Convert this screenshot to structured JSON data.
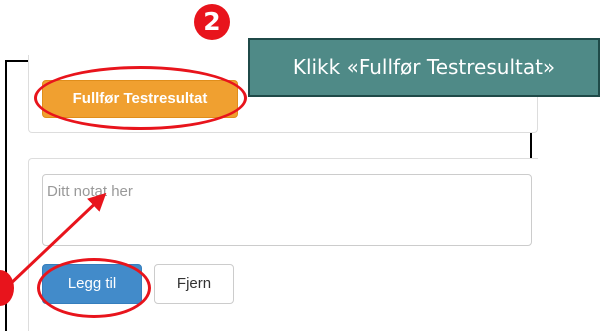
{
  "callout": {
    "text": "Klikk «Fullfør Testresultat»",
    "step_number": "2",
    "accent_color": "#e8141c",
    "box_color": "#4f8a87"
  },
  "actions": {
    "finish_label": "Fullfør Testresultat",
    "finish_color": "#f0a030"
  },
  "note": {
    "placeholder": "Ditt notat her",
    "value": "",
    "add_label": "Legg til",
    "remove_label": "Fjern",
    "add_color": "#428bca"
  }
}
